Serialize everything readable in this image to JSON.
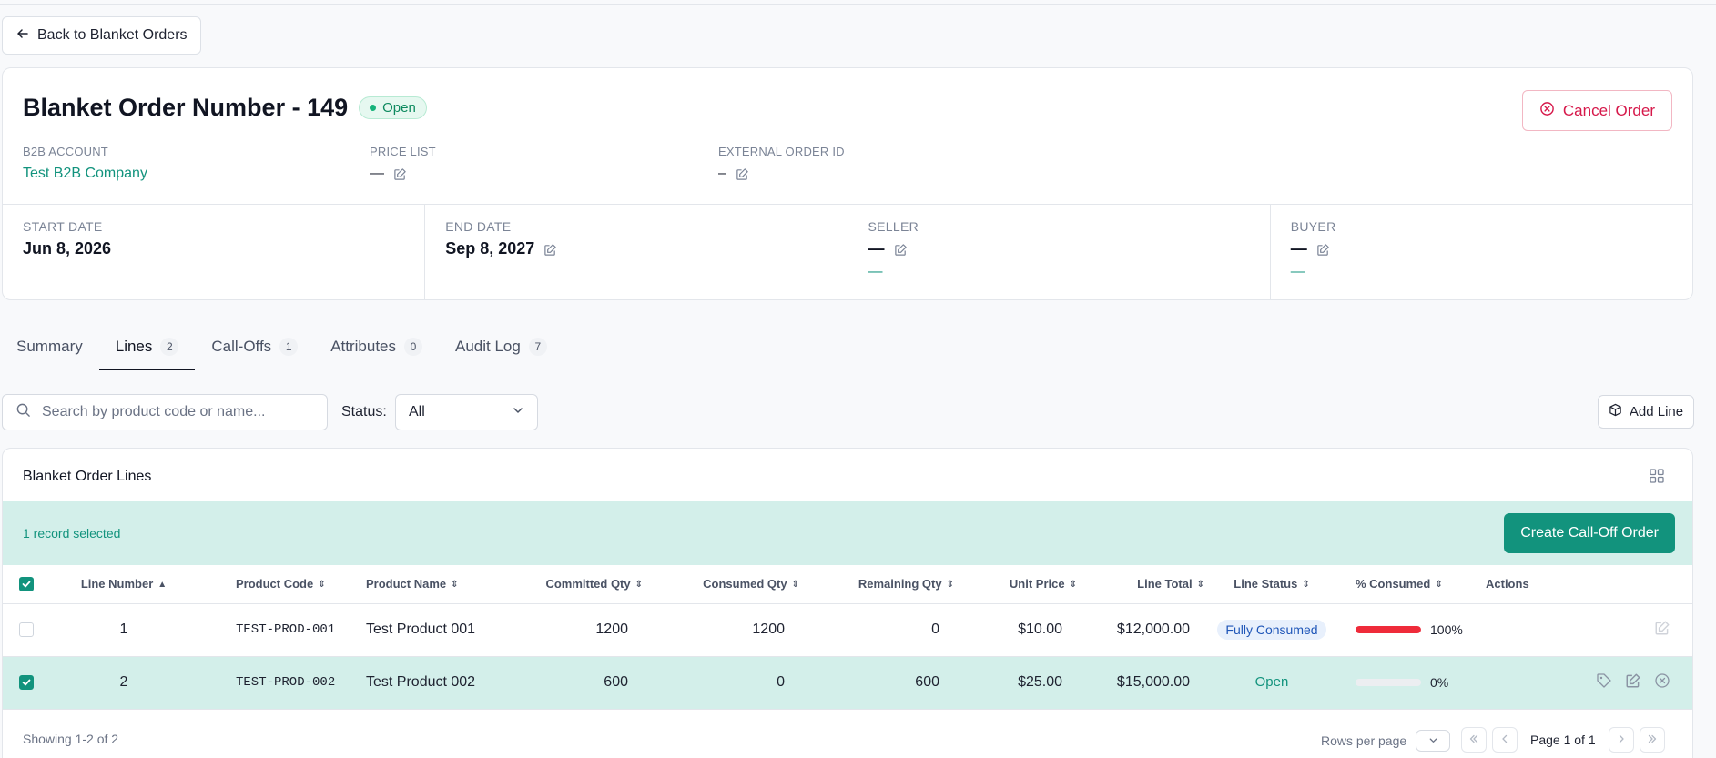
{
  "nav": {
    "back_label": "Back to Blanket Orders"
  },
  "order": {
    "title": "Blanket Order Number - 149",
    "status": "Open",
    "cancel_label": "Cancel Order",
    "b2b_account_label": "B2B ACCOUNT",
    "b2b_account_value": "Test B2B Company",
    "price_list_label": "PRICE LIST",
    "price_list_value": "—",
    "external_order_id_label": "EXTERNAL ORDER ID",
    "external_order_id_value": "–",
    "start_date_label": "START DATE",
    "start_date_value": "Jun 8, 2026",
    "end_date_label": "END DATE",
    "end_date_value": "Sep 8, 2027",
    "seller_label": "SELLER",
    "seller_value": "—",
    "seller_sub": "—",
    "buyer_label": "BUYER",
    "buyer_value": "—",
    "buyer_sub": "—"
  },
  "tabs": [
    {
      "label": "Summary",
      "count": ""
    },
    {
      "label": "Lines",
      "count": "2"
    },
    {
      "label": "Call-Offs",
      "count": "1"
    },
    {
      "label": "Attributes",
      "count": "0"
    },
    {
      "label": "Audit Log",
      "count": "7"
    }
  ],
  "toolbar": {
    "search_placeholder": "Search by product code or name...",
    "status_label": "Status:",
    "status_value": "All",
    "add_line_label": "Add Line"
  },
  "lines_table": {
    "title": "Blanket Order Lines",
    "selection_text": "1 record selected",
    "create_calloff_label": "Create Call-Off Order",
    "columns": [
      "Line Number",
      "Product Code",
      "Product Name",
      "Committed Qty",
      "Consumed Qty",
      "Remaining Qty",
      "Unit Price",
      "Line Total",
      "Line Status",
      "% Consumed",
      "Actions"
    ],
    "rows": [
      {
        "line_number": "1",
        "product_code": "TEST-PROD-001",
        "product_name": "Test Product 001",
        "committed_qty": "1200",
        "consumed_qty": "1200",
        "remaining_qty": "0",
        "unit_price": "$10.00",
        "line_total": "$12,000.00",
        "line_status": "Fully Consumed",
        "consumed_pct": "100%",
        "consumed_fraction": 1.0,
        "selected": false
      },
      {
        "line_number": "2",
        "product_code": "TEST-PROD-002",
        "product_name": "Test Product 002",
        "committed_qty": "600",
        "consumed_qty": "0",
        "remaining_qty": "600",
        "unit_price": "$25.00",
        "line_total": "$15,000.00",
        "line_status": "Open",
        "consumed_pct": "0%",
        "consumed_fraction": 0.0,
        "selected": true
      }
    ],
    "showing_text": "Showing 1-2 of 2",
    "rows_per_page_label": "Rows per page",
    "page_text": "Page 1 of 1"
  },
  "colors": {
    "accent": "#12937d",
    "danger": "#d6184a",
    "selected_row": "#d3efea",
    "progress_full": "#ef2b3a"
  },
  "icons": [
    "arrow-left-icon",
    "circle-x-icon",
    "edit-icon",
    "search-icon",
    "chevron-down-icon",
    "package-icon",
    "grid-view-icon",
    "checkbox-icon",
    "tag-icon",
    "chevrons-left-icon",
    "chevron-left-icon",
    "chevron-right-icon",
    "chevrons-right-icon"
  ]
}
